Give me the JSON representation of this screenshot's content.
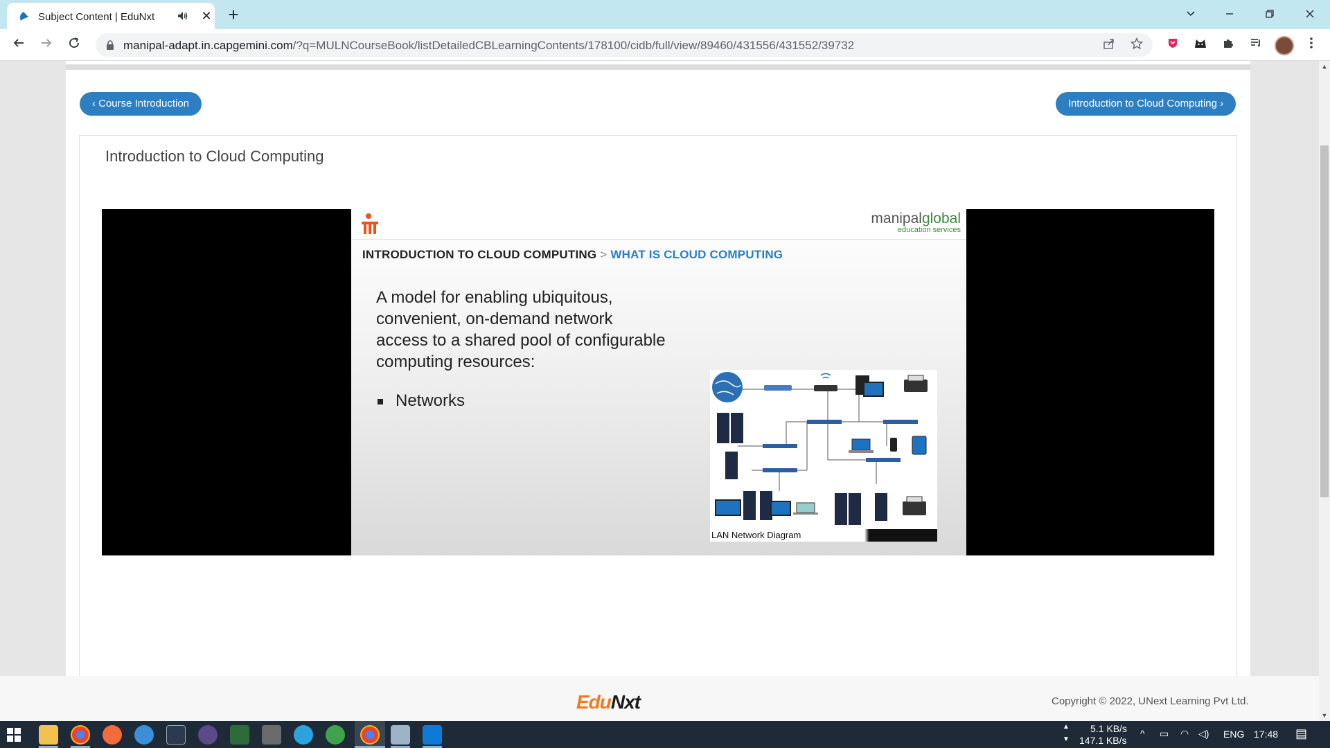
{
  "browser": {
    "tab_title": "Subject Content | EduNxt",
    "url_host": "manipal-adapt.in.capgemini.com",
    "url_path": "/?q=MULNCourseBook/listDetailedCBLearningContents/178100/cidb/full/view/89460/431556/431552/39732",
    "new_tab_glyph": "+",
    "close_glyph": "✕"
  },
  "nav": {
    "prev_label": "‹ Course Introduction",
    "next_label": "Introduction to Cloud Computing ›"
  },
  "lesson": {
    "title": "Introduction to Cloud Computing"
  },
  "slide": {
    "brand_main": "manipal",
    "brand_main_accent": "global",
    "brand_sub": "education services",
    "crumb_section": "INTRODUCTION TO CLOUD COMPUTING",
    "crumb_sep": ">",
    "crumb_current": "WHAT IS CLOUD COMPUTING",
    "body_text": "A model for enabling ubiquitous, convenient, on-demand network access to a shared pool of configurable computing resources:",
    "bullets": [
      "Networks"
    ],
    "diagram_caption": "LAN Network Diagram",
    "diagram_labels": [
      "internet",
      "router",
      "wifi router",
      "client",
      "printer",
      "servers 1",
      "hub switch",
      "hub switch",
      "hub switch",
      "laptop",
      "mobile phone",
      "tablet",
      "server 2",
      "hub switch",
      "hub switch",
      "servers 1",
      "server 2",
      "client",
      "client",
      "laptop",
      "printer"
    ]
  },
  "footer": {
    "logo_a": "Edu",
    "logo_b": "Nxt",
    "copyright": "Copyright © 2022, UNext Learning Pvt Ltd."
  },
  "taskbar": {
    "net_up": "5.1 KB/s",
    "net_down": "147.1 KB/s",
    "lang": "ENG",
    "time": "17:48"
  },
  "colors": {
    "accent_blue": "#2d7fc1",
    "tab_strip": "#c2e7f0",
    "edunxt_orange": "#f07a21",
    "taskbar": "#1f2a38"
  }
}
